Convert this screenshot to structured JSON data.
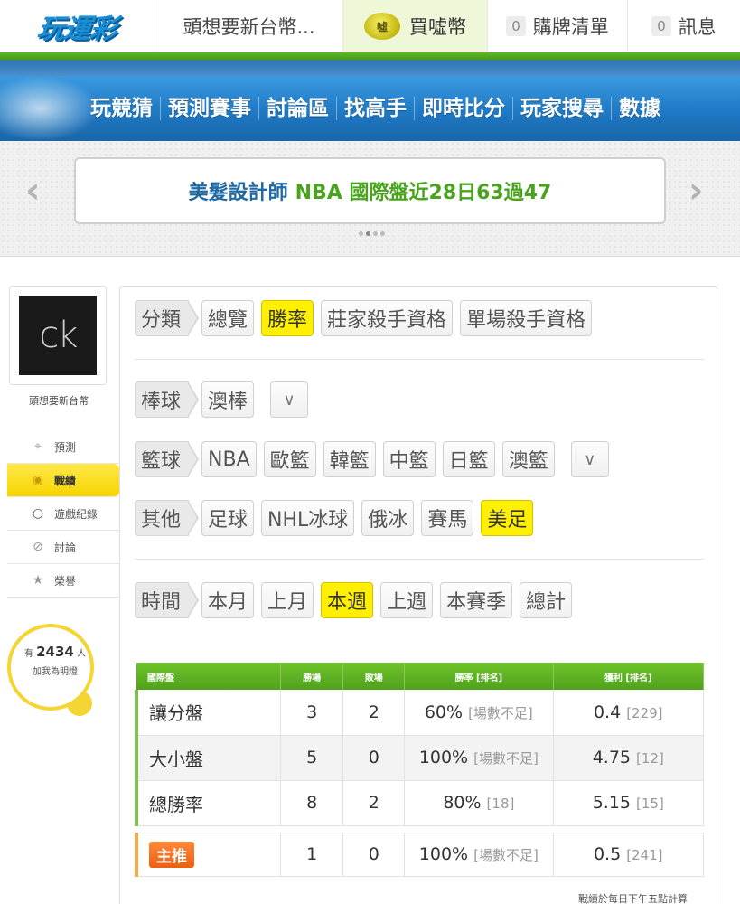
{
  "header": {
    "logo": "玩運彩",
    "user_name": "頭想要新台幣...",
    "buy_coin_icon_text": "噓",
    "buy_coin": "買噓幣",
    "cart_count": "0",
    "cart_label": "購牌清單",
    "msg_count": "0",
    "msg_label": "訊息"
  },
  "nav": [
    "玩競猜",
    "預測賽事",
    "討論區",
    "找高手",
    "即時比分",
    "玩家搜尋",
    "數據"
  ],
  "banner": {
    "name": "美髮設計師",
    "text": "NBA 國際盤近28日63過47",
    "prev": "‹",
    "next": "›"
  },
  "sidebar": {
    "avatar_text": "ck",
    "username": "頭想要新台幣",
    "menu": [
      {
        "label": "預測",
        "icon": "target-icon"
      },
      {
        "label": "戰績",
        "icon": "medal-icon"
      },
      {
        "label": "遊戲紀錄",
        "icon": "circle-icon"
      },
      {
        "label": "討論",
        "icon": "chat-icon"
      },
      {
        "label": "榮譽",
        "icon": "trophy-icon"
      }
    ],
    "bulb": {
      "prefix": "有",
      "count": "2434",
      "suffix": "人",
      "text": "加我為明燈"
    }
  },
  "filters": {
    "category": {
      "label": "分類",
      "items": [
        "總覽",
        "勝率",
        "莊家殺手資格",
        "單場殺手資格"
      ],
      "active": "勝率"
    },
    "baseball": {
      "label": "棒球",
      "items": [
        "澳棒"
      ]
    },
    "basketball": {
      "label": "籃球",
      "items": [
        "NBA",
        "歐籃",
        "韓籃",
        "中籃",
        "日籃",
        "澳籃"
      ]
    },
    "other": {
      "label": "其他",
      "items": [
        "足球",
        "NHL冰球",
        "俄冰",
        "賽馬",
        "美足"
      ],
      "active": "美足"
    },
    "time": {
      "label": "時間",
      "items": [
        "本月",
        "上月",
        "本週",
        "上週",
        "本賽季",
        "總計"
      ],
      "active": "本週"
    },
    "dropdown": "∨"
  },
  "table": {
    "headers": [
      "國際盤",
      "勝場",
      "敗場",
      "勝率 [排名]",
      "獲利 [排名]"
    ],
    "rows": [
      {
        "name": "讓分盤",
        "win": "3",
        "lose": "2",
        "rate": "60%",
        "rate_rank": "[場數不足]",
        "profit": "0.4",
        "profit_rank": "[229]"
      },
      {
        "name": "大小盤",
        "win": "5",
        "lose": "0",
        "rate": "100%",
        "rate_rank": "[場數不足]",
        "profit": "4.75",
        "profit_rank": "[12]"
      },
      {
        "name": "總勝率",
        "win": "8",
        "lose": "2",
        "rate": "80%",
        "rate_rank": "[18]",
        "profit": "5.15",
        "profit_rank": "[15]"
      }
    ],
    "main": {
      "name": "主推",
      "win": "1",
      "lose": "0",
      "rate": "100%",
      "rate_rank": "[場數不足]",
      "profit": "0.5",
      "profit_rank": "[241]"
    }
  },
  "footnote": "戰績於每日下午五點計算"
}
